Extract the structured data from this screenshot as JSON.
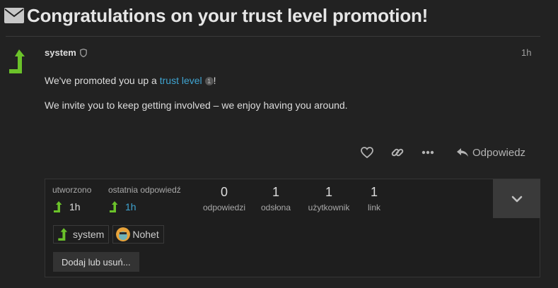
{
  "topic": {
    "title": "Congratulations on your trust level promotion!"
  },
  "post": {
    "username": "system",
    "age": "1h",
    "line1_prefix": "We've promoted you up a ",
    "line1_link": "trust level",
    "line1_badge": "1",
    "line1_suffix": "!",
    "line2": "We invite you to keep getting involved – we enjoy having you around."
  },
  "actions": {
    "reply_label": "Odpowiedz"
  },
  "summary": {
    "created_label": "utworzono",
    "created_time": "1h",
    "last_reply_label": "ostatnia odpowiedź",
    "last_reply_time": "1h",
    "stats": [
      {
        "value": "0",
        "label": "odpowiedzi"
      },
      {
        "value": "1",
        "label": "odsłona"
      },
      {
        "value": "1",
        "label": "użytkownik"
      },
      {
        "value": "1",
        "label": "link"
      }
    ],
    "participants": [
      {
        "name": "system"
      },
      {
        "name": "Nohet"
      }
    ],
    "add_remove_label": "Dodaj lub usuń..."
  },
  "colors": {
    "background": "#222222",
    "accent_green": "#6bc22a",
    "link_blue": "#3fa4d1"
  },
  "icons": [
    "envelope-icon",
    "shield-icon",
    "heart-icon",
    "link-icon",
    "more-icon",
    "reply-icon",
    "chevron-down-icon"
  ]
}
